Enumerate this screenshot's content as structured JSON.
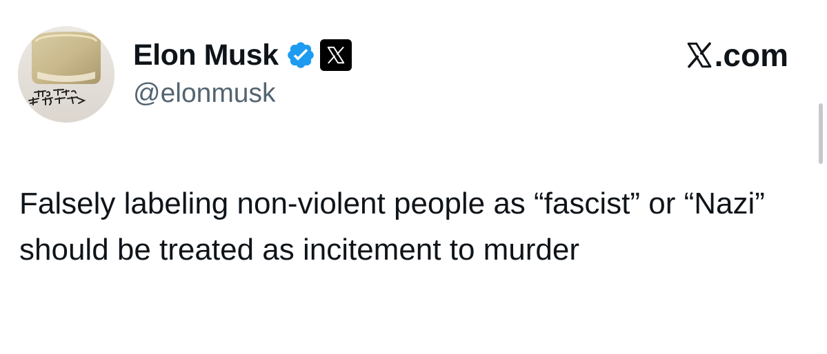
{
  "author": {
    "display_name": "Elon Musk",
    "handle": "@elonmusk",
    "verified_badge_color": "#1d9bf0",
    "affiliation_badge": "x-logo-icon"
  },
  "brand": {
    "label": ".com",
    "logo": "x-logo-icon"
  },
  "tweet": {
    "text": "Falsely labeling non-violent people as “fascist” or “Nazi” should be treated as incitement to murder"
  },
  "colors": {
    "text_primary": "#0f1419",
    "text_secondary": "#536471",
    "background": "#ffffff"
  }
}
